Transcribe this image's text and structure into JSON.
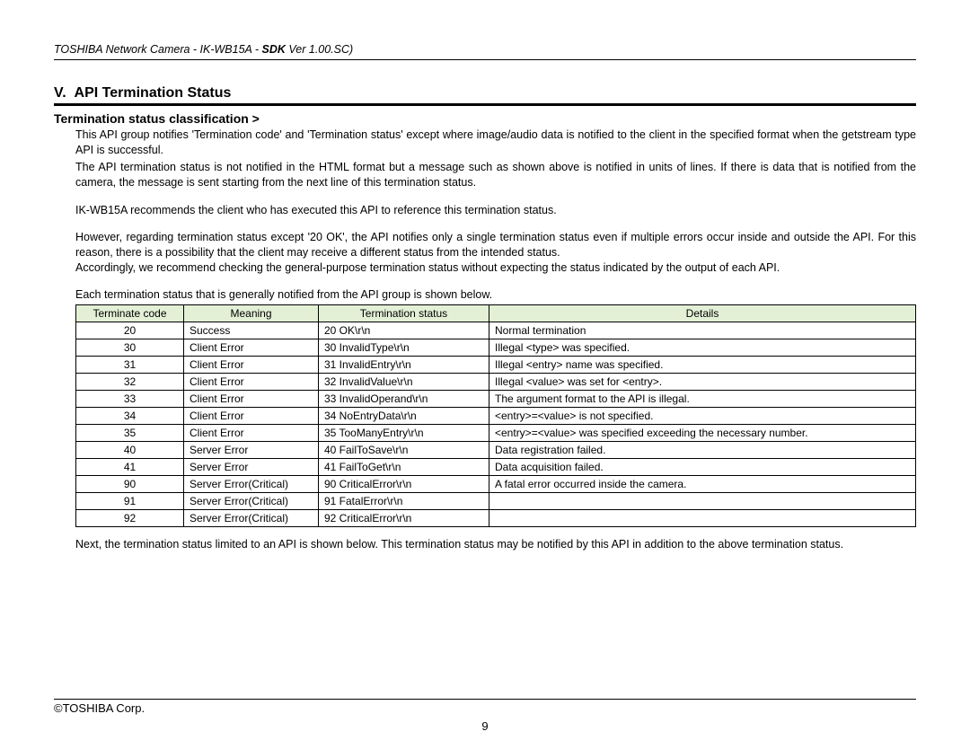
{
  "header": {
    "product": "TOSHIBA Network Camera - IK-WB15A - ",
    "sdk_label": "SDK",
    "version": " Ver 1.00.SC)"
  },
  "section": {
    "number": "V.",
    "title": "API Termination Status"
  },
  "subsection": {
    "title": "Termination status classification >"
  },
  "paragraphs": {
    "p1": "This API group notifies 'Termination code' and 'Termination status' except where image/audio data is notified to the client in the specified format when the getstream type API is successful.",
    "p2": "The API termination status is not notified in the HTML format but a message such as shown above is notified in units of lines. If there is data that is notified from the camera, the message is sent starting from the next line of this termination status.",
    "p3": "IK-WB15A recommends the client who has executed this API to reference this termination status.",
    "p4": "However, regarding termination status except '20 OK', the API notifies only a single termination status even if multiple errors occur inside and outside the API. For this reason, there is a possibility that the client may receive a different status from the intended status.",
    "p5": "Accordingly, we recommend checking the general-purpose termination status without expecting the status indicated by the output of each API.",
    "table_intro": "Each termination status that is generally notified from the API group is shown below.",
    "after": "Next, the termination status limited to an API is shown below. This termination status may be notified by this API in addition to the above termination status."
  },
  "table": {
    "headers": [
      "Terminate code",
      "Meaning",
      "Termination status",
      "Details"
    ],
    "rows": [
      {
        "code": "20",
        "meaning": "Success",
        "status": "20 OK\\r\\n",
        "details": "Normal termination"
      },
      {
        "code": "30",
        "meaning": "Client Error",
        "status": "30 InvalidType\\r\\n",
        "details": "Illegal <type> was specified."
      },
      {
        "code": "31",
        "meaning": "Client Error",
        "status": "31 InvalidEntry\\r\\n",
        "details": "Illegal <entry> name was specified."
      },
      {
        "code": "32",
        "meaning": "Client Error",
        "status": "32 InvalidValue\\r\\n",
        "details": "Illegal <value> was set for <entry>."
      },
      {
        "code": "33",
        "meaning": "Client Error",
        "status": "33 InvalidOperand\\r\\n",
        "details": "The argument format to the API is illegal."
      },
      {
        "code": "34",
        "meaning": "Client Error",
        "status": "34 NoEntryData\\r\\n",
        "details": "<entry>=<value> is not specified."
      },
      {
        "code": "35",
        "meaning": "Client Error",
        "status": "35 TooManyEntry\\r\\n",
        "details": "<entry>=<value> was specified exceeding the necessary number."
      },
      {
        "code": "40",
        "meaning": "Server Error",
        "status": "40 FailToSave\\r\\n",
        "details": "Data registration failed."
      },
      {
        "code": "41",
        "meaning": "Server Error",
        "status": "41 FailToGet\\r\\n",
        "details": "Data acquisition failed."
      },
      {
        "code": "90",
        "meaning": "Server Error(Critical)",
        "status": "90 CriticalError\\r\\n",
        "details": "A fatal error occurred inside the camera."
      },
      {
        "code": "91",
        "meaning": "Server Error(Critical)",
        "status": "91 FatalError\\r\\n",
        "details": ""
      },
      {
        "code": "92",
        "meaning": "Server Error(Critical)",
        "status": "92 CriticalError\\r\\n",
        "details": ""
      }
    ]
  },
  "footer": {
    "copyright": "©TOSHIBA Corp.",
    "page": "9"
  }
}
